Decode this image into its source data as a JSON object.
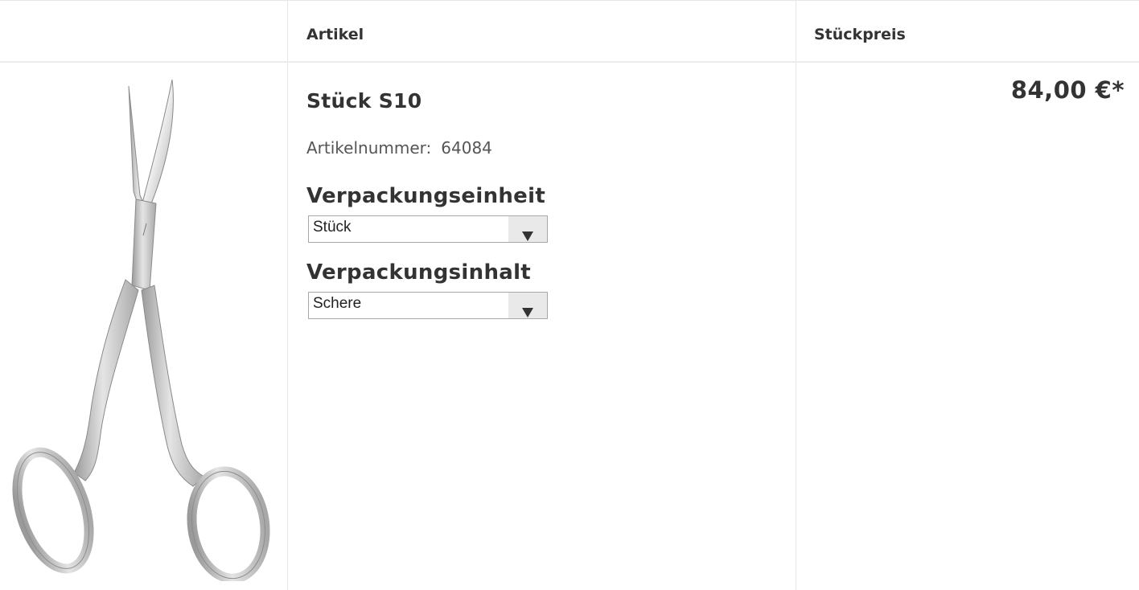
{
  "table": {
    "headers": {
      "article": "Artikel",
      "unit_price": "Stückpreis"
    }
  },
  "product": {
    "title": "Stück S10",
    "article_number_label": "Artikelnummer:",
    "article_number": "64084",
    "price": "84,00 €*",
    "image_icon": "surgical-scissors-icon",
    "packaging_unit": {
      "label": "Verpackungseinheit",
      "selected": "Stück"
    },
    "packaging_content": {
      "label": "Verpackungsinhalt",
      "selected": "Schere"
    }
  },
  "colors": {
    "border": "#e6e6e6",
    "text": "#333333",
    "select_arrow_bg": "#e9e9e9"
  }
}
